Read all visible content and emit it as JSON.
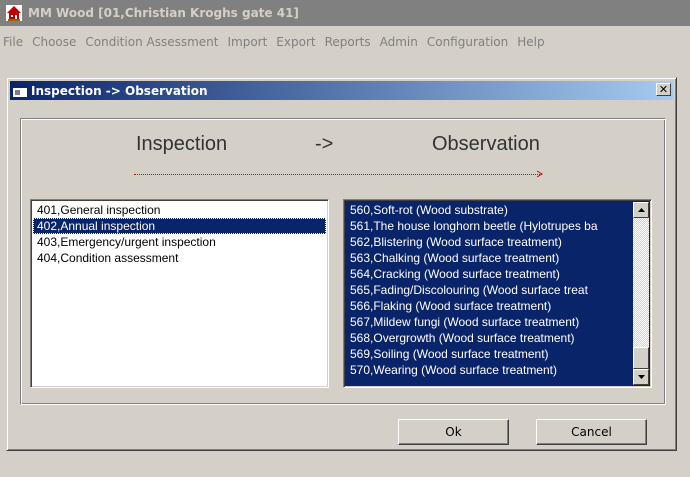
{
  "app": {
    "title": "MM Wood  [01,Christian Kroghs gate 41]"
  },
  "menu": [
    "File",
    "Choose",
    "Condition Assessment",
    "Import",
    "Export",
    "Reports",
    "Admin",
    "Configuration",
    "Help"
  ],
  "dialog": {
    "title": "Inspection -> Observation",
    "close_label": "✕",
    "header_left": "Inspection",
    "header_arrow": "->",
    "header_right": "Observation",
    "ok_label": "Ok",
    "cancel_label": "Cancel"
  },
  "inspections": {
    "items": [
      "401,General inspection",
      "402,Annual inspection",
      "403,Emergency/urgent inspection",
      "404,Condition assessment"
    ],
    "selected_index": 1
  },
  "observations": {
    "items": [
      "560,Soft-rot (Wood substrate)",
      "561,The house longhorn beetle (Hylotrupes ba",
      "562,Blistering (Wood surface treatment)",
      "563,Chalking (Wood surface treatment)",
      "564,Cracking (Wood surface treatment)",
      "565,Fading/Discolouring (Wood surface treat",
      "566,Flaking (Wood surface treatment)",
      "567,Mildew fungi (Wood surface treatment)",
      "568,Overgrowth (Wood surface treatment)",
      "569,Soiling (Wood surface treatment)",
      "570,Wearing (Wood surface treatment)"
    ]
  },
  "colors": {
    "selection": "#0a246a",
    "arrow": "#e00000"
  }
}
